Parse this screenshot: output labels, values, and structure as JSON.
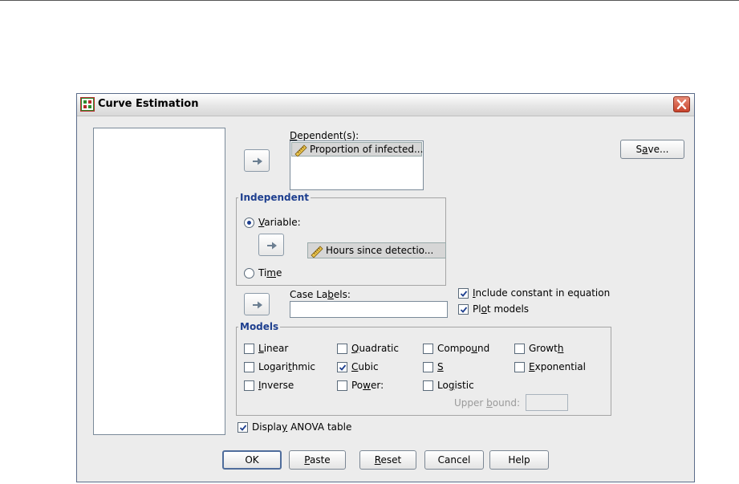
{
  "window": {
    "title": "Curve Estimation"
  },
  "dependents": {
    "label": "Dependent(s):",
    "items": [
      "Proportion of infected..."
    ]
  },
  "independent": {
    "group_title": "Independent",
    "variable_label": "Variable:",
    "variable_value": "Hours since detectio...",
    "time_label": "Time",
    "selected": "Variable"
  },
  "case_labels": {
    "label": "Case Labels:",
    "value": ""
  },
  "options": {
    "include_constant": "Include constant in equation",
    "plot_models": "Plot models",
    "display_anova": "Display ANOVA table"
  },
  "models": {
    "group_title": "Models",
    "linear": "Linear",
    "quadratic": "Quadratic",
    "compound": "Compound",
    "growth": "Growth",
    "logarithmic": "Logarithmic",
    "cubic": "Cubic",
    "s": "S",
    "exponential": "Exponential",
    "inverse": "Inverse",
    "power": "Power:",
    "logistic": "Logistic",
    "upper_bound": "Upper bound:"
  },
  "buttons": {
    "save": "Save...",
    "ok": "OK",
    "paste": "Paste",
    "reset": "Reset",
    "cancel": "Cancel",
    "help": "Help"
  },
  "checked": {
    "include_constant": true,
    "plot_models": true,
    "display_anova": true,
    "linear": false,
    "quadratic": false,
    "compound": false,
    "growth": false,
    "logarithmic": false,
    "cubic": true,
    "s": false,
    "exponential": false,
    "inverse": false,
    "power": false,
    "logistic": false
  },
  "icons": {
    "title": "curve-estimation-app-icon",
    "close": "close-icon",
    "arrow": "move-right-arrow-icon",
    "variable": "scale-ruler-icon"
  },
  "colors": {
    "group_title": "#1e3f8f",
    "close": "#c8432b"
  }
}
